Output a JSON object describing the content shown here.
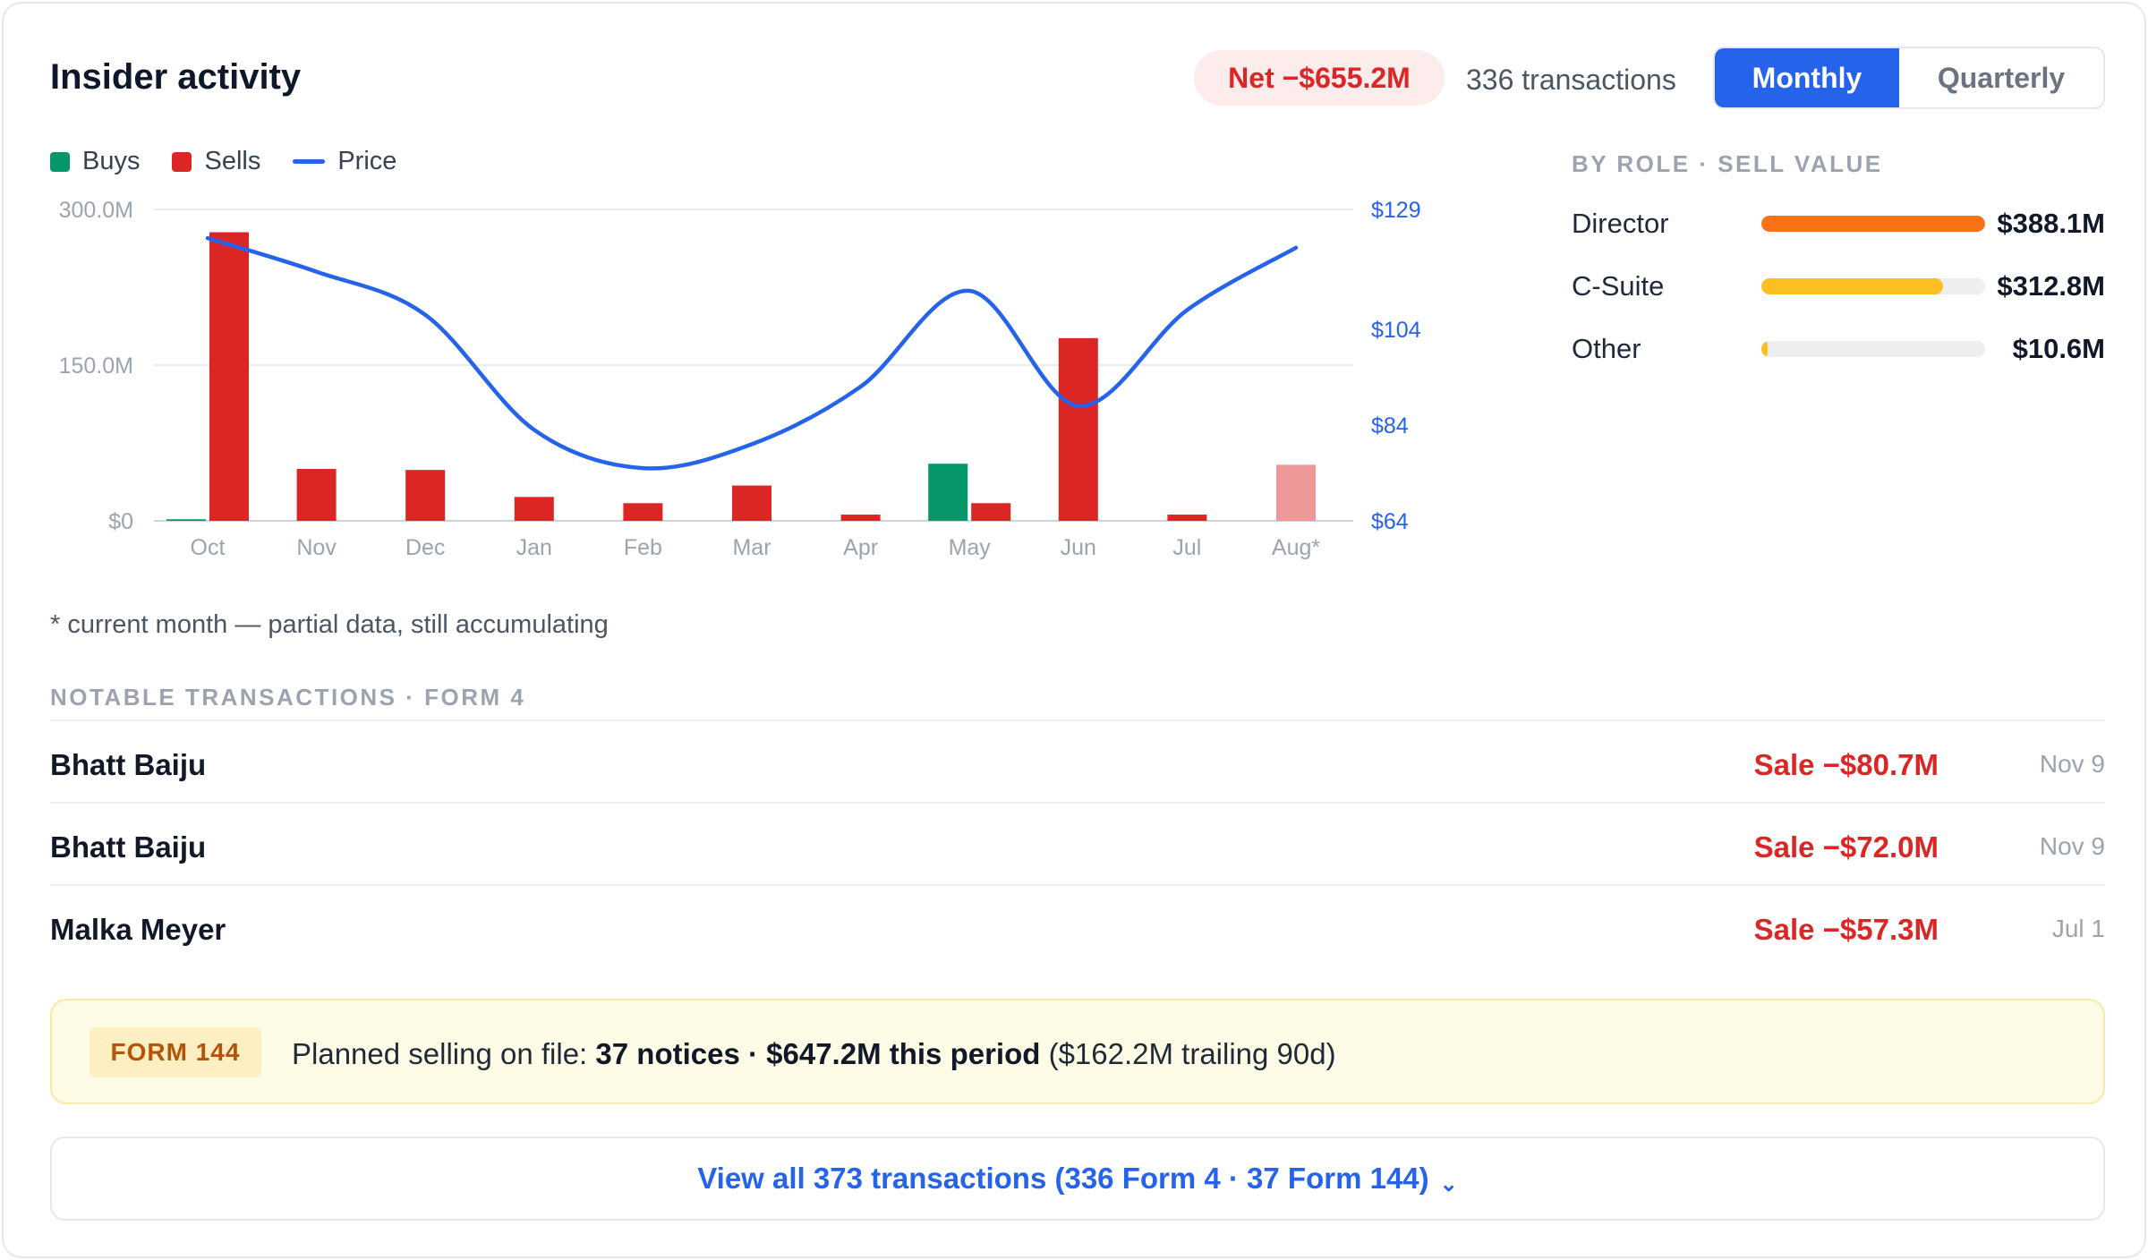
{
  "header": {
    "title": "Insider activity",
    "net_badge": "Net −$655.2M",
    "transactions": "336 transactions",
    "toggle": {
      "monthly": "Monthly",
      "quarterly": "Quarterly",
      "active": "Monthly"
    }
  },
  "legend": {
    "buys": "Buys",
    "sells": "Sells",
    "price": "Price"
  },
  "colors": {
    "buys": "#059669",
    "sells": "#dc2626",
    "sells_partial": "#ee9999",
    "price": "#2563eb",
    "accent": "#2563eb",
    "director": "#f97316",
    "csuite": "#fbbf24",
    "other": "#fbbf24"
  },
  "chart_data": {
    "type": "bar",
    "categories": [
      "Oct",
      "Nov",
      "Dec",
      "Jan",
      "Feb",
      "Mar",
      "Apr",
      "May",
      "Jun",
      "Jul",
      "Aug*"
    ],
    "series": [
      {
        "name": "Buys",
        "values": [
          1.5,
          0,
          0,
          0,
          0,
          0,
          0,
          55,
          0,
          0,
          0
        ]
      },
      {
        "name": "Sells",
        "values": [
          278,
          50,
          49,
          23,
          17,
          34,
          6,
          17,
          176,
          6,
          54
        ],
        "partial_last": true
      },
      {
        "name": "Price",
        "type": "line",
        "axis": "right",
        "values": [
          123,
          116,
          107,
          83,
          75,
          80,
          92,
          112,
          88,
          108,
          121
        ]
      }
    ],
    "left_axis": {
      "ticks": [
        "300.0M",
        "150.0M",
        "$0"
      ],
      "ylim": [
        0,
        300
      ]
    },
    "right_axis": {
      "ticks": [
        "$129",
        "$104",
        "$84",
        "$64"
      ],
      "ylim": [
        64,
        129
      ]
    },
    "grid": true,
    "legend_position": "top-left",
    "footnote": "* current month — partial data, still accumulating"
  },
  "by_role": {
    "title": "BY ROLE · SELL VALUE",
    "items": [
      {
        "label": "Director",
        "value": "$388.1M",
        "fraction": 1.0,
        "color": "#f97316"
      },
      {
        "label": "C-Suite",
        "value": "$312.8M",
        "fraction": 0.81,
        "color": "#fbbf24"
      },
      {
        "label": "Other",
        "value": "$10.6M",
        "fraction": 0.027,
        "color": "#fbbf24"
      }
    ]
  },
  "notable": {
    "title": "NOTABLE TRANSACTIONS · FORM 4",
    "rows": [
      {
        "name": "Bhatt Baiju",
        "amount": "Sale −$80.7M",
        "date": "Nov 9"
      },
      {
        "name": "Bhatt Baiju",
        "amount": "Sale −$72.0M",
        "date": "Nov 9"
      },
      {
        "name": "Malka Meyer",
        "amount": "Sale −$57.3M",
        "date": "Jul 1"
      }
    ]
  },
  "form144": {
    "tag": "FORM 144",
    "prefix": "Planned selling on file: ",
    "bold": "37 notices · $647.2M this period",
    "suffix": " ($162.2M trailing 90d)"
  },
  "view_all": {
    "label": "View all 373 transactions (336 Form 4 · 37 Form 144)",
    "chevron": "⌄"
  }
}
